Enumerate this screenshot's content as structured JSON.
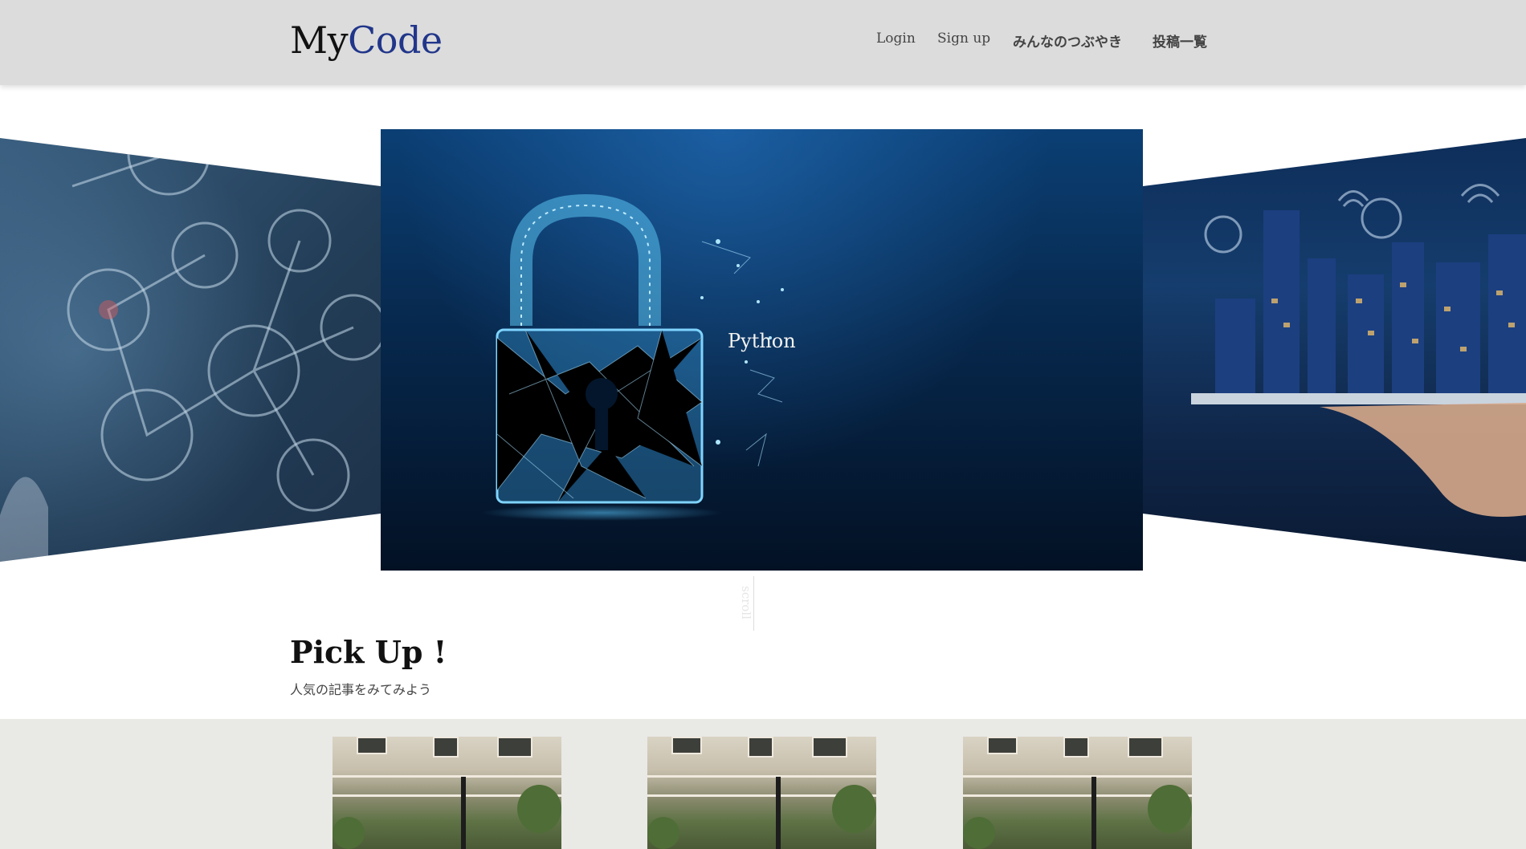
{
  "header": {
    "logo_part1": "My",
    "logo_part2": "Code",
    "logo_accent_color": "#21368a",
    "nav": [
      {
        "label": "Login"
      },
      {
        "label": "Sign up"
      },
      {
        "label": "みんなのつぶやき"
      },
      {
        "label": "投稿一覧"
      }
    ]
  },
  "hero": {
    "slide_title": "Python",
    "scroll_label": "scroll"
  },
  "pickup": {
    "title": "Pick Up !",
    "subtitle": "人気の記事をみてみよう"
  }
}
